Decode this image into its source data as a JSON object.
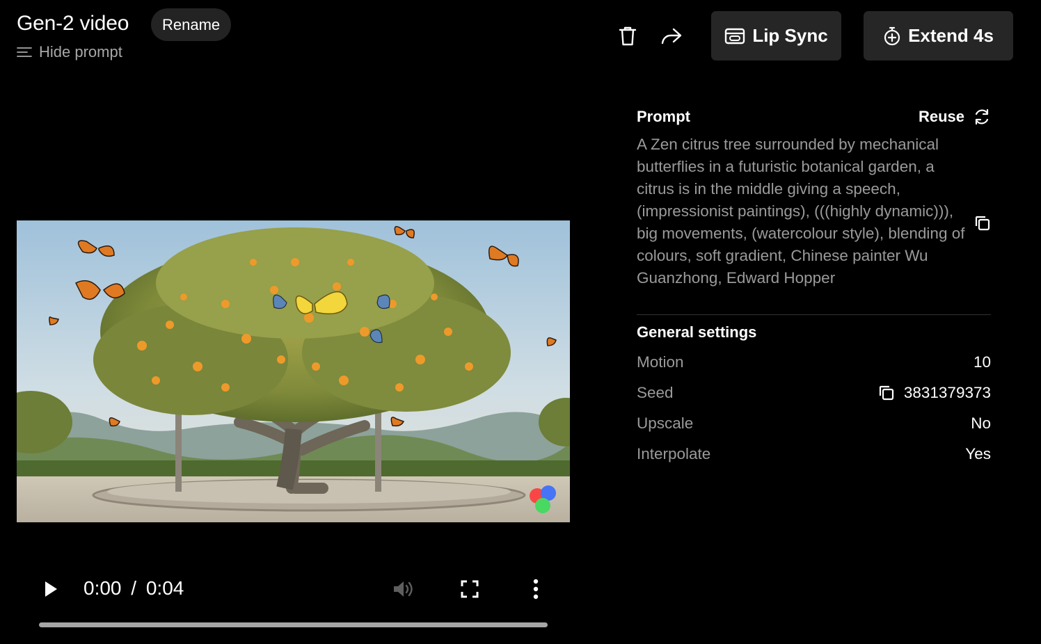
{
  "header": {
    "title": "Gen-2 video",
    "rename_label": "Rename",
    "hide_prompt_label": "Hide prompt"
  },
  "toolbar": {
    "delete_icon": "trash-icon",
    "share_icon": "share-arrow-icon",
    "lip_sync_label": "Lip Sync",
    "extend_label": "Extend 4s"
  },
  "player": {
    "current_time": "0:00",
    "separator": "/",
    "duration": "0:04",
    "progress": 0
  },
  "prompt": {
    "label": "Prompt",
    "reuse_label": "Reuse",
    "text": "A Zen citrus tree surrounded by mechanical butterflies in a futuristic botanical garden, a citrus is in the middle giving a speech, (impressionist paintings), (((highly dynamic))), big movements, (watercolour style), blending of colours, soft gradient, Chinese painter Wu Guanzhong, Edward Hopper"
  },
  "settings": {
    "title": "General settings",
    "rows": [
      {
        "key": "Motion",
        "value": "10"
      },
      {
        "key": "Seed",
        "value": "3831379373"
      },
      {
        "key": "Upscale",
        "value": "No"
      },
      {
        "key": "Interpolate",
        "value": "Yes"
      }
    ]
  },
  "colors": {
    "background": "#000000",
    "button_bg": "#262626",
    "muted_text": "#9a9a9a",
    "progress_track": "#a6a6a6"
  }
}
